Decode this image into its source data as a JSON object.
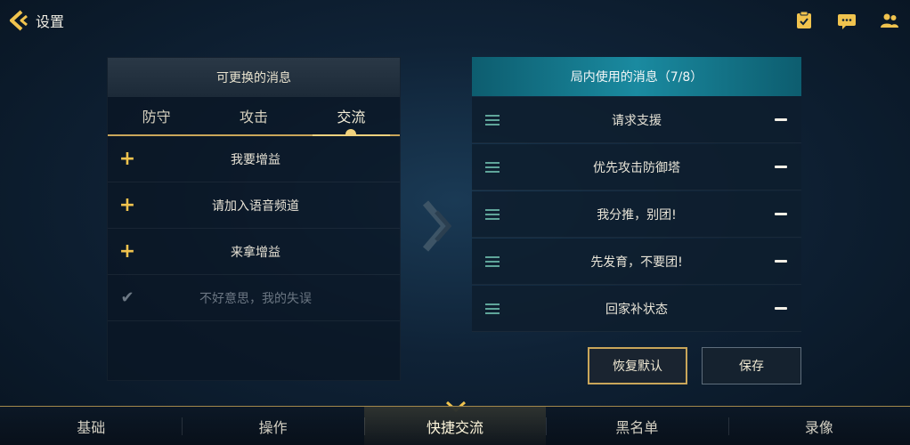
{
  "header": {
    "back_label": "设置",
    "icons": [
      "task-icon",
      "chat-icon",
      "friends-icon"
    ]
  },
  "left_panel": {
    "title": "可更换的消息",
    "tabs": [
      {
        "label": "防守",
        "active": false
      },
      {
        "label": "攻击",
        "active": false
      },
      {
        "label": "交流",
        "active": true
      }
    ],
    "items": [
      {
        "label": "我要增益",
        "state": "addable"
      },
      {
        "label": "请加入语音频道",
        "state": "addable"
      },
      {
        "label": "来拿增益",
        "state": "addable"
      },
      {
        "label": "不好意思，我的失误",
        "state": "added"
      }
    ]
  },
  "right_panel": {
    "title": "局内使用的消息（7/8）",
    "items": [
      {
        "label": "请求支援"
      },
      {
        "label": "优先攻击防御塔"
      },
      {
        "label": "我分推，别团!"
      },
      {
        "label": "先发育，不要团!"
      },
      {
        "label": "回家补状态"
      }
    ]
  },
  "buttons": {
    "reset": "恢复默认",
    "save": "保存"
  },
  "bottom_nav": [
    {
      "label": "基础",
      "active": false
    },
    {
      "label": "操作",
      "active": false
    },
    {
      "label": "快捷交流",
      "active": true
    },
    {
      "label": "黑名单",
      "active": false
    },
    {
      "label": "录像",
      "active": false
    }
  ],
  "colors": {
    "accent_gold": "#f0c34e",
    "accent_teal": "#1a8aa0",
    "background": "#0f2236"
  }
}
